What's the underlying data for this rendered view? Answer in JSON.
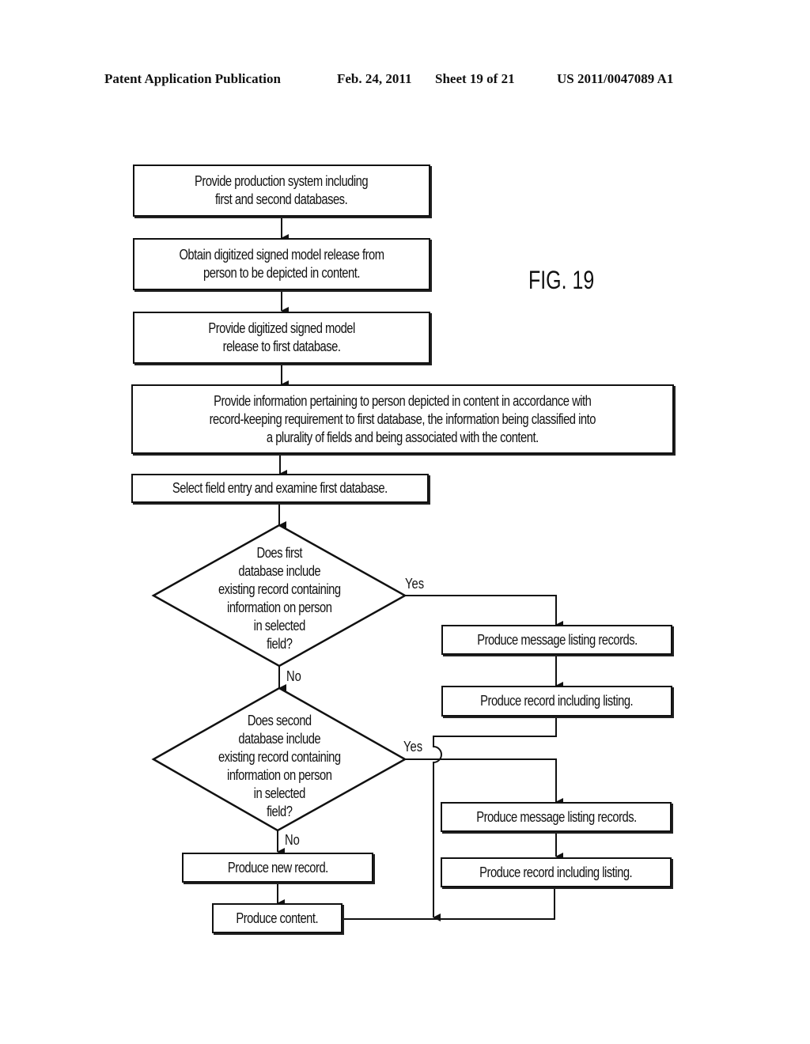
{
  "header": {
    "publication": "Patent Application Publication",
    "date": "Feb. 24, 2011",
    "sheet": "Sheet 19 of 21",
    "number": "US 2011/0047089 A1"
  },
  "figure_label": "FIG. 19",
  "nodes": {
    "step1": "Provide production system including\nfirst and second databases.",
    "step2": "Obtain digitized signed model release from\nperson to be depicted in content.",
    "step3": "Provide digitized signed model\nrelease to first database.",
    "step4": "Provide information pertaining to person depicted in content in accordance with\nrecord-keeping requirement to first database, the information being classified into\na plurality of fields and being associated with the content.",
    "step5": "Select field entry and examine first database.",
    "decision1": "Does first\ndatabase include\nexisting record containing\ninformation on person\nin selected\nfield?",
    "decision2": "Does second\ndatabase include\nexisting record containing\ninformation on person\nin selected\nfield?",
    "yes1_a": "Produce message listing records.",
    "yes1_b": "Produce record including listing.",
    "yes2_a": "Produce message listing records.",
    "yes2_b": "Produce record including listing.",
    "new_record": "Produce new record.",
    "produce_content": "Produce content."
  },
  "edge_labels": {
    "yes": "Yes",
    "no": "No"
  }
}
